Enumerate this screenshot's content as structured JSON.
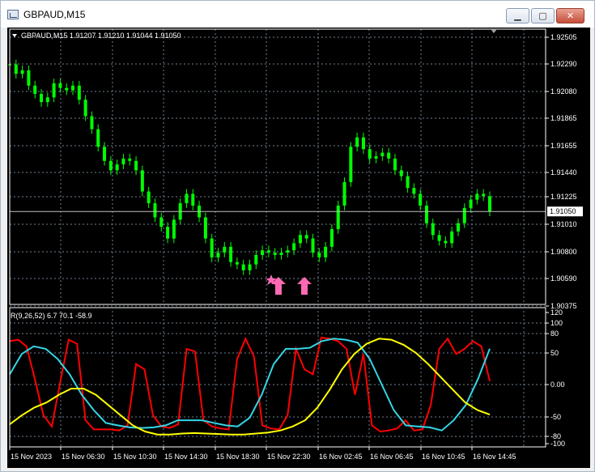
{
  "window": {
    "title": "GBPAUD,M15",
    "min_glyph": "▁",
    "max_glyph": "▢",
    "close_glyph": "✕"
  },
  "price_panel": {
    "header": "GBPAUD,M15  1.91207 1.91210 1.91044 1.91050",
    "current_price": "1.91050",
    "y_labels": [
      "1.92505",
      "1.92290",
      "1.92080",
      "1.91865",
      "1.91655",
      "1.91440",
      "1.91225",
      "1.91010",
      "1.90800",
      "1.90590",
      "1.90375"
    ]
  },
  "indicator_panel": {
    "header": "R(9,26,52) 6.7 70.1 -58.9",
    "y_labels": [
      "120",
      "100",
      "80",
      "50",
      "0.00",
      "-50",
      "-80",
      "-100"
    ]
  },
  "time_axis": [
    "15 Nov 2023",
    "15 Nov 06:30",
    "15 Nov 10:30",
    "15 Nov 14:30",
    "15 Nov 18:30",
    "15 Nov 22:30",
    "16 Nov 02:45",
    "16 Nov 06:45",
    "16 Nov 10:45",
    "16 Nov 14:45"
  ],
  "colors": {
    "candles": "#00ff00",
    "price_line": "#c0c0c0",
    "grid": "#708090",
    "arrows": "#ff69b4",
    "fast_line": "#ff0000",
    "mid_line": "#33d6e6",
    "slow_line": "#ffff00"
  },
  "markers": [
    "star",
    "up-arrow",
    "up-arrow"
  ],
  "chart_data": {
    "type": "line",
    "title": "GBPAUD,M15",
    "price_ylim": [
      1.9026,
      1.926
    ],
    "price_close": [
      1.923,
      1.9222,
      1.9225,
      1.9212,
      1.9205,
      1.9198,
      1.9202,
      1.9214,
      1.921,
      1.9208,
      1.9212,
      1.92,
      1.9186,
      1.9175,
      1.916,
      1.9148,
      1.914,
      1.9145,
      1.915,
      1.9148,
      1.914,
      1.9122,
      1.9112,
      1.91,
      1.9092,
      1.9082,
      1.9098,
      1.9112,
      1.912,
      1.911,
      1.91,
      1.9082,
      1.9066,
      1.907,
      1.9075,
      1.9062,
      1.906,
      1.9055,
      1.906,
      1.9068,
      1.9072,
      1.907,
      1.9068,
      1.907,
      1.9072,
      1.9078,
      1.9085,
      1.9082,
      1.907,
      1.9066,
      1.9075,
      1.909,
      1.911,
      1.913,
      1.916,
      1.9168,
      1.9158,
      1.915,
      1.9152,
      1.9155,
      1.915,
      1.914,
      1.9135,
      1.9125,
      1.912,
      1.911,
      1.9095,
      1.9085,
      1.908,
      1.9078,
      1.9088,
      1.9095,
      1.9108,
      1.9115,
      1.912,
      1.9118,
      1.9105
    ],
    "indicator_ylim": [
      -110,
      120
    ],
    "series": [
      {
        "name": "R(9)",
        "values": [
          85,
          88,
          75,
          10,
          -60,
          -82,
          5,
          88,
          80,
          -70,
          -88,
          -88,
          -88,
          -90,
          -80,
          40,
          30,
          -60,
          -82,
          -85,
          -78,
          70,
          65,
          -70,
          -82,
          -86,
          -88,
          50,
          90,
          55,
          -80,
          -86,
          -88,
          -60,
          70,
          30,
          20,
          92,
          90,
          85,
          70,
          -20,
          60,
          -80,
          -92,
          -90,
          -86,
          -70,
          -90,
          -88,
          -40,
          70,
          90,
          60,
          70,
          85,
          75,
          6.7
        ]
      },
      {
        "name": "R(26)",
        "values": [
          20,
          60,
          75,
          70,
          50,
          20,
          -20,
          -50,
          -75,
          -80,
          -84,
          -85,
          -84,
          -80,
          -70,
          -70,
          -70,
          -75,
          -80,
          -82,
          -65,
          -20,
          40,
          70,
          70,
          72,
          85,
          90,
          88,
          82,
          50,
          0,
          -50,
          -80,
          -82,
          -84,
          -90,
          -70,
          -40,
          10,
          70.1
        ]
      },
      {
        "name": "R(52)",
        "values": [
          -78,
          -60,
          -45,
          -35,
          -20,
          -8,
          -8,
          -20,
          -40,
          -60,
          -80,
          -92,
          -98,
          -98,
          -96,
          -95,
          -96,
          -97,
          -98,
          -98,
          -96,
          -94,
          -90,
          -82,
          -70,
          -45,
          -10,
          30,
          60,
          80,
          90,
          88,
          78,
          62,
          40,
          15,
          -10,
          -35,
          -50,
          -58.9
        ]
      }
    ]
  }
}
